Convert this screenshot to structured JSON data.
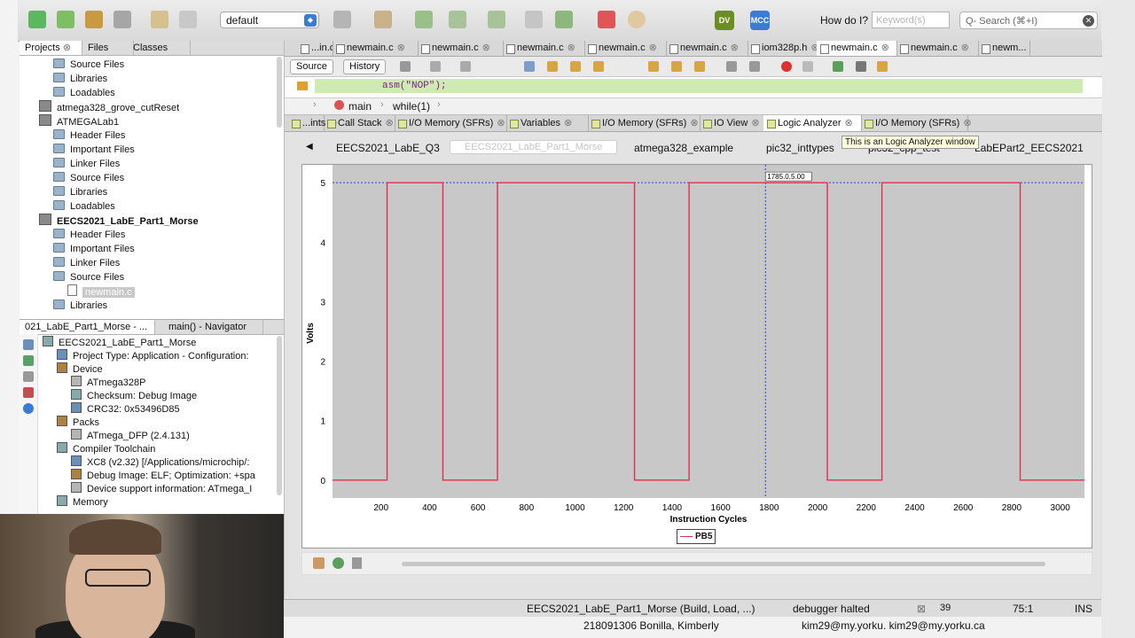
{
  "toolbar": {
    "configuration": "default",
    "how_do_i": "How do I?",
    "keyword_placeholder": "Keyword(s)",
    "search_placeholder": "Q- Search (⌘+I)",
    "badges": [
      "DV",
      "MCC"
    ]
  },
  "projects_panel": {
    "tabs": [
      "Projects",
      "Files",
      "Classes"
    ],
    "tree": [
      {
        "label": "Source Files",
        "indent": 2,
        "icon": "folder"
      },
      {
        "label": "Libraries",
        "indent": 2,
        "icon": "folder"
      },
      {
        "label": "Loadables",
        "indent": 2,
        "icon": "folder"
      },
      {
        "label": "atmega328_grove_cutReset",
        "indent": 1,
        "icon": "project"
      },
      {
        "label": "ATMEGALab1",
        "indent": 1,
        "icon": "project"
      },
      {
        "label": "Header Files",
        "indent": 2,
        "icon": "folder"
      },
      {
        "label": "Important Files",
        "indent": 2,
        "icon": "folder"
      },
      {
        "label": "Linker Files",
        "indent": 2,
        "icon": "folder"
      },
      {
        "label": "Source Files",
        "indent": 2,
        "icon": "folder"
      },
      {
        "label": "Libraries",
        "indent": 2,
        "icon": "folder"
      },
      {
        "label": "Loadables",
        "indent": 2,
        "icon": "folder"
      },
      {
        "label": "EECS2021_LabE_Part1_Morse",
        "indent": 1,
        "icon": "project",
        "bold": true
      },
      {
        "label": "Header Files",
        "indent": 2,
        "icon": "folder"
      },
      {
        "label": "Important Files",
        "indent": 2,
        "icon": "folder"
      },
      {
        "label": "Linker Files",
        "indent": 2,
        "icon": "folder"
      },
      {
        "label": "Source Files",
        "indent": 2,
        "icon": "folder"
      },
      {
        "label": "newmain.c",
        "indent": 3,
        "icon": "file",
        "selected": true
      },
      {
        "label": "Libraries",
        "indent": 2,
        "icon": "folder"
      }
    ]
  },
  "navigator_panel": {
    "tabs": [
      "021_LabE_Part1_Morse - ...",
      "main() - Navigator"
    ],
    "items": [
      {
        "label": "EECS2021_LabE_Part1_Morse",
        "indent": 0
      },
      {
        "label": "Project Type: Application - Configuration:",
        "indent": 1
      },
      {
        "label": "Device",
        "indent": 1
      },
      {
        "label": "ATmega328P",
        "indent": 2
      },
      {
        "label": "Checksum: Debug Image",
        "indent": 2
      },
      {
        "label": "CRC32: 0x53496D85",
        "indent": 2
      },
      {
        "label": "Packs",
        "indent": 1
      },
      {
        "label": "ATmega_DFP (2.4.131)",
        "indent": 2
      },
      {
        "label": "Compiler Toolchain",
        "indent": 1
      },
      {
        "label": "XC8 (v2.32) [/Applications/microchip/:",
        "indent": 2
      },
      {
        "label": "Debug Image: ELF; Optimization: +spa",
        "indent": 2
      },
      {
        "label": "Device support information: ATmega_I",
        "indent": 2
      },
      {
        "label": "Memory",
        "indent": 1
      }
    ]
  },
  "editor": {
    "file_tabs": [
      "...in.c",
      "newmain.c",
      "newmain.c",
      "newmain.c",
      "newmain.c",
      "newmain.c",
      "iom328p.h",
      "newmain.c",
      "newmain.c",
      "newm..."
    ],
    "active_file_tab": 7,
    "source_label": "Source",
    "history_label": "History",
    "code_line": "asm(\"NOP\");",
    "breadcrumbs": [
      "main",
      "while(1)"
    ]
  },
  "output_panel": {
    "tabs": [
      "...ints",
      "Call Stack",
      "I/O Memory (SFRs)",
      "Variables",
      "I/O Memory (SFRs)",
      "IO View",
      "Logic Analyzer",
      "I/O Memory (SFRs)"
    ],
    "active_tab": 6,
    "sub_tabs": [
      "EECS2021_LabE_Q3",
      "EECS2021_LabE_Part1_Morse",
      "atmega328_example",
      "pic32_inttypes",
      "pic32_cpp_test",
      "LabEPart2_EECS2021"
    ],
    "active_sub_tab": 1,
    "tooltip": "This is an Logic Analyzer window"
  },
  "chart_data": {
    "type": "line",
    "title": "",
    "xlabel": "Instruction Cycles",
    "ylabel": "Volts",
    "xlim": [
      0,
      3100
    ],
    "ylim": [
      -0.3,
      5.3
    ],
    "xticks": [
      200,
      400,
      600,
      800,
      1000,
      1200,
      1400,
      1600,
      1800,
      2000,
      2200,
      2400,
      2600,
      2800,
      3000
    ],
    "yticks": [
      0,
      1,
      2,
      3,
      4,
      5
    ],
    "cursor_x": 1785,
    "cursor_label": "1785.0,5.00",
    "reference_level": 5,
    "grid": false,
    "legend": "bottom-center",
    "series": [
      {
        "name": "PB5",
        "color": "#e03050",
        "x": [
          0,
          225,
          225,
          455,
          455,
          680,
          680,
          1245,
          1245,
          1470,
          1470,
          2040,
          2040,
          2265,
          2265,
          2835,
          2835,
          3100
        ],
        "y": [
          0,
          0,
          5,
          5,
          0,
          0,
          5,
          5,
          0,
          0,
          5,
          5,
          0,
          0,
          5,
          5,
          0,
          0
        ]
      }
    ]
  },
  "status_bar": {
    "project": "EECS2021_LabE_Part1_Morse (Build, Load, ...)",
    "state": "debugger halted",
    "count": "39",
    "position": "75:1",
    "mode": "INS"
  },
  "desktop_bottom": {
    "row_text": "218091306   Bonilla, Kimberly",
    "email_text": "kim29@my.yorku.   kim29@my.yorku.ca"
  }
}
